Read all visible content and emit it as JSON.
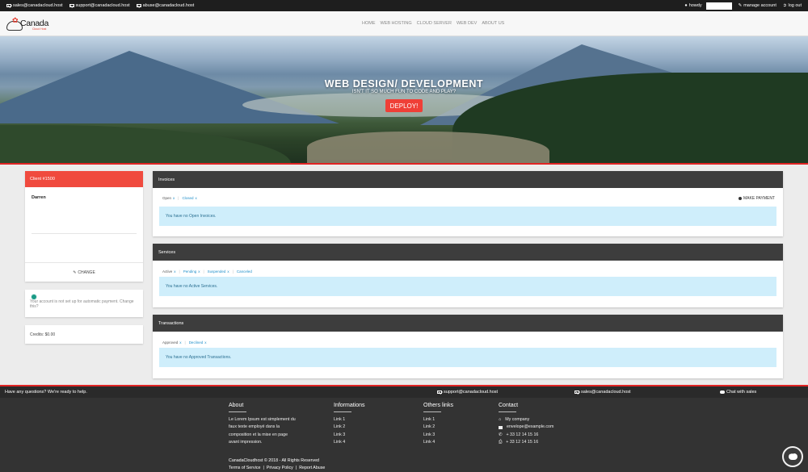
{
  "topbar": {
    "emails": [
      "sales@canadacloud.host",
      "support@canadacloud.host",
      "abuse@canadacloud.host"
    ],
    "howdy": "howdy",
    "manage_account": "manage account",
    "logout": "log out"
  },
  "logo": {
    "name": "Canada",
    "sub": "Cloud Host"
  },
  "nav": {
    "items": [
      "HOME",
      "WEB HOSTING",
      "CLOUD SERVER",
      "WEB DEV",
      "ABOUT US"
    ]
  },
  "hero": {
    "title": "WEB DESIGN/ DEVELOPMENT",
    "subtitle": "ISN'T IT SO MUCH FUN TO CODE AND PLAY?",
    "button": "DEPLOY!"
  },
  "client": {
    "header": "Client #1500",
    "name": "Darren",
    "change": "CHANGE"
  },
  "auto_payment": {
    "text": "Your account is not set up for automatic payment. Change this?"
  },
  "credits": {
    "text": "Credits: $0.00"
  },
  "invoices": {
    "title": "Invoices",
    "filters": [
      "Open",
      "Closed"
    ],
    "make_payment": "MAKE PAYMENT",
    "message": "You have no Open Invoices."
  },
  "services": {
    "title": "Services",
    "filters": [
      "Active",
      "Pending",
      "Suspended",
      "Canceled"
    ],
    "message": "You have no Active Services."
  },
  "transactions": {
    "title": "Transactions",
    "filters": [
      "Approved",
      "Declined"
    ],
    "message": "You have no Approved Transactions."
  },
  "footer_top": {
    "question": "Have any questions? We're ready to help.",
    "support": "support@canadacloud.host",
    "sales": "sales@canadacloud.host",
    "chat": "Chat with sales"
  },
  "footer": {
    "about": {
      "title": "About",
      "text": [
        "Le Lorem Ipsum est simplement du",
        "faux texte employé dans la",
        "composition et la mise en page",
        "avant impression."
      ]
    },
    "informations": {
      "title": "Informations",
      "links": [
        "Link 1",
        "Link 2",
        "Link 3",
        "Link 4"
      ]
    },
    "others": {
      "title": "Others links",
      "links": [
        "Link 1",
        "Link 2",
        "Link 3",
        "Link 4"
      ]
    },
    "contact": {
      "title": "Contact",
      "items": [
        "My company",
        "envelope@example.com",
        "+ 33 12 14 15 16",
        "+ 33 12 14 15 16"
      ]
    },
    "copyright": "CanadaCloudhost © 2018 - All Rights Reserved",
    "terms": [
      "Terms of Service",
      "Privacy Policy",
      "Report Abuse"
    ]
  },
  "colors": {
    "accent": "#f04a3e",
    "panel_header": "#3d3d3d",
    "alert_bg": "#cfeefb",
    "link": "#1e8ec9"
  }
}
